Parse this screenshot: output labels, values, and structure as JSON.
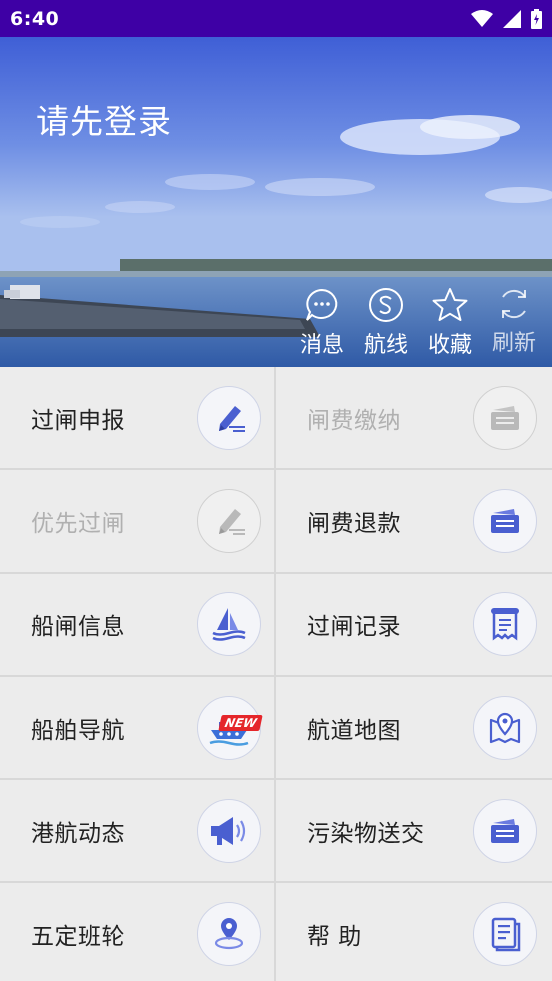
{
  "status_bar": {
    "time": "6:40"
  },
  "header": {
    "login_prompt": "请先登录",
    "actions": [
      {
        "label": "消息",
        "icon": "chat-bubble-icon"
      },
      {
        "label": "航线",
        "icon": "route-s-icon"
      },
      {
        "label": "收藏",
        "icon": "star-icon"
      },
      {
        "label": "刷新",
        "icon": "refresh-icon"
      }
    ]
  },
  "menu": [
    {
      "label": "过闸申报",
      "icon": "edit-pen-icon",
      "enabled": true
    },
    {
      "label": "闸费缴纳",
      "icon": "card-wallet-icon",
      "enabled": false
    },
    {
      "label": "优先过闸",
      "icon": "edit-pen-icon",
      "enabled": false
    },
    {
      "label": "闸费退款",
      "icon": "card-wallet-icon",
      "enabled": true
    },
    {
      "label": "船闸信息",
      "icon": "sailboat-icon",
      "enabled": true
    },
    {
      "label": "过闸记录",
      "icon": "receipt-scroll-icon",
      "enabled": true
    },
    {
      "label": "船舶导航",
      "icon": "ship-icon",
      "enabled": true,
      "badge": "NEW"
    },
    {
      "label": "航道地图",
      "icon": "map-pin-icon",
      "enabled": true
    },
    {
      "label": "港航动态",
      "icon": "megaphone-icon",
      "enabled": true
    },
    {
      "label": "污染物送交",
      "icon": "card-wallet-icon",
      "enabled": true
    },
    {
      "label": "五定班轮",
      "icon": "location-pin-icon",
      "enabled": true
    },
    {
      "label": "帮 助",
      "icon": "document-list-icon",
      "enabled": true
    }
  ],
  "colors": {
    "status_bar": "#3e00a5",
    "icon_blue": "#4a5fd0",
    "icon_disabled": "#b9b9b9",
    "badge_red": "#e5262b"
  }
}
